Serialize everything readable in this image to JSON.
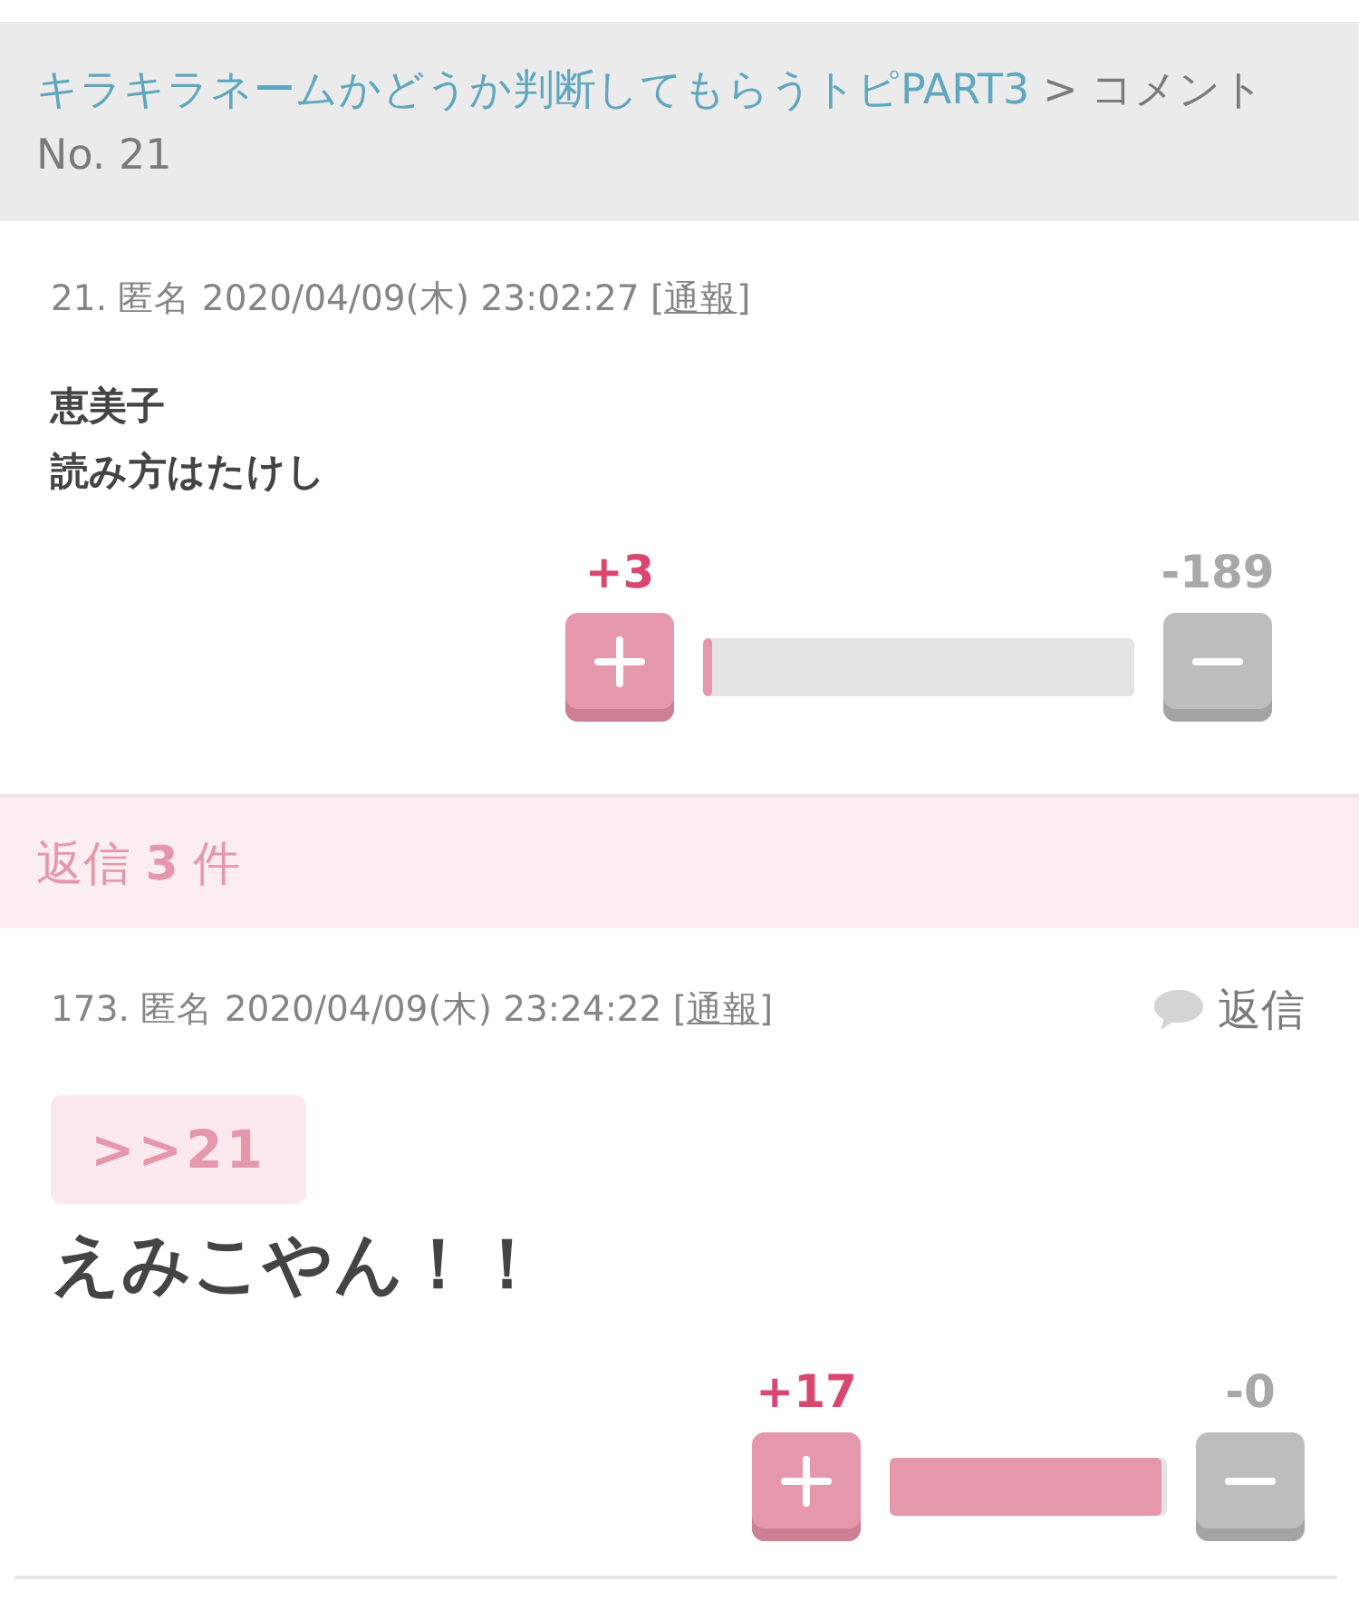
{
  "breadcrumb": {
    "topic": "キラキラネームかどうか判断してもらうトピPART3",
    "separator": ">",
    "current": "コメント No. 21"
  },
  "comment": {
    "meta": "21. 匿名 2020/04/09(木) 23:02:27",
    "report": {
      "brackets": [
        "[",
        "]"
      ],
      "label": "通報"
    },
    "body": [
      "恵美子",
      "読み方はたけし"
    ],
    "votes": {
      "plus": "+3",
      "minus": "-189",
      "level": 0.02
    }
  },
  "replies_header": "返信 **3** 件",
  "replies": [
    {
      "meta": "173. 匿名 2020/04/09(木) 23:24:22",
      "report": {
        "brackets": [
          "[",
          "]"
        ],
        "label": "通報"
      },
      "reply_button": "返信",
      "quote": ">>21",
      "body": "えみこやん！！",
      "votes": {
        "plus": "+17",
        "minus": "-0",
        "level": 0.98
      }
    }
  ]
}
